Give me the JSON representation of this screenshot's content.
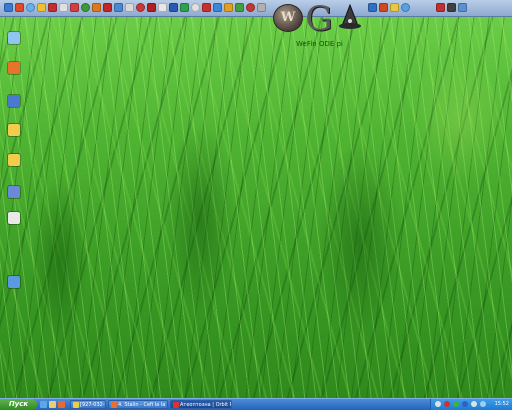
{
  "desktop": {
    "wallpaper": "green grass",
    "logo": {
      "w_letter": "W",
      "g_letter": "G",
      "caption": "WeFin ODE pi"
    },
    "icons": [
      {
        "name": "my-computer-icon",
        "label": "",
        "color": "#8fc6f0"
      },
      {
        "name": "firefox-icon",
        "label": "",
        "color": "#e8742a"
      },
      {
        "name": "program-icon",
        "label": "",
        "color": "#4a7ad0"
      },
      {
        "name": "folder-icon",
        "label": "",
        "color": "#f2cc4a"
      },
      {
        "name": "folder-icon",
        "label": "",
        "color": "#f2cc4a"
      },
      {
        "name": "app-icon",
        "label": "",
        "color": "#6a8ad8"
      },
      {
        "name": "document-icon",
        "label": "",
        "color": "#e8e8e8"
      },
      {
        "name": "network-icon",
        "label": "",
        "color": "#5a9ae0"
      }
    ]
  },
  "toolbar": {
    "quick_icons": [
      "#3a7ad0",
      "#e04a2a",
      "#6ab0e8",
      "#f0c030",
      "#c03030",
      "#e0e0e0",
      "#d04040",
      "#3a9a3a",
      "#e07820",
      "#c02828",
      "#4a88d0",
      "#d8d8d8",
      "#c83838",
      "#b02020",
      "#e8e8e8",
      "#2a5ab0",
      "#30a050",
      "#e0e0e0",
      "#c83030",
      "#3a88d8",
      "#e0a020",
      "#40a040",
      "#c03838",
      "#b0b0b0",
      "#3070c0",
      "#d04a20",
      "#e8c840",
      "#5aa0e0",
      "#c03030",
      "#404040",
      "#5a90d0"
    ]
  },
  "taskbar": {
    "start_label": "Пуск",
    "tasks": [
      {
        "label": "[927-032-003] - Ом...",
        "icon_color": "#e8d040",
        "active": false
      },
      {
        "label": "4. Stalin - Cefi la la ...",
        "icon_color": "#e87030",
        "active": false
      },
      {
        "label": "Атeoптoзна | Orbit P...",
        "icon_color": "#e03030",
        "active": true
      }
    ],
    "clock": "15:52"
  }
}
